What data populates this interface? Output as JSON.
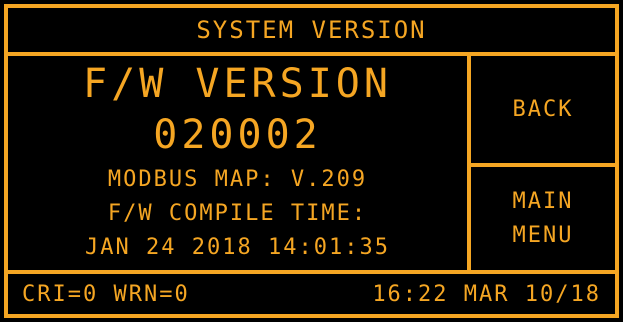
{
  "screen": {
    "title": "SYSTEM VERSION"
  },
  "info": {
    "fw_label": "F/W VERSION",
    "fw_number": "020002",
    "modbus_map": "MODBUS MAP: V.209",
    "compile_label": "F/W COMPILE TIME:",
    "compile_time": "JAN 24 2018 14:01:35"
  },
  "buttons": {
    "back": "BACK",
    "main_menu_line1": "MAIN",
    "main_menu_line2": "MENU"
  },
  "status": {
    "alarms": "CRI=0 WRN=0",
    "datetime": "16:22 MAR 10/18"
  },
  "colors": {
    "accent": "#f5a623",
    "background": "#000000"
  }
}
